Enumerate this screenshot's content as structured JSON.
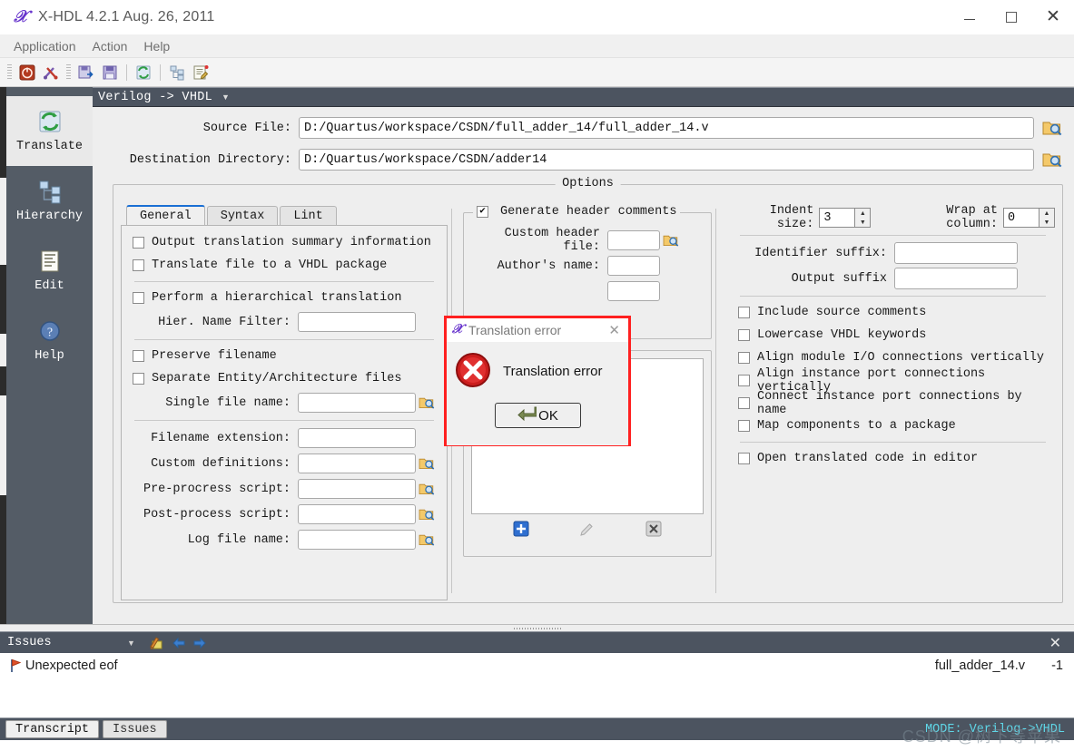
{
  "window": {
    "title": "X-HDL 4.2.1  Aug. 26, 2011",
    "app_icon": "x-hdl-logo-icon",
    "minimize": "–",
    "maximize": "□",
    "close": "✕"
  },
  "menubar": {
    "items": [
      {
        "label": "Application"
      },
      {
        "label": "Action"
      },
      {
        "label": "Help"
      }
    ]
  },
  "toolbar": {
    "buttons": [
      {
        "name": "exit-icon"
      },
      {
        "name": "settings-tools-icon"
      },
      {
        "name": "save-as-icon"
      },
      {
        "name": "save-icon"
      },
      {
        "name": "translate-icon"
      },
      {
        "name": "hierarchy-icon"
      },
      {
        "name": "edit-icon"
      }
    ]
  },
  "sidebar": {
    "items": [
      {
        "label": "Translate",
        "icon": "translate-icon",
        "active": true
      },
      {
        "label": "Hierarchy",
        "icon": "hierarchy-icon",
        "active": false
      },
      {
        "label": "Edit",
        "icon": "edit-document-icon",
        "active": false
      },
      {
        "label": "Help",
        "icon": "help-question-icon",
        "active": false
      }
    ]
  },
  "mode": {
    "label": "Verilog -> VHDL",
    "caret": "▼"
  },
  "paths": {
    "source_label": "Source File:",
    "source_value": "D:/Quartus/workspace/CSDN/full_adder_14/full_adder_14.v",
    "dest_label": "Destination Directory:",
    "dest_value": "D:/Quartus/workspace/CSDN/adder14"
  },
  "options": {
    "group_title": "Options",
    "tabs": [
      {
        "label": "General",
        "active": true
      },
      {
        "label": "Syntax",
        "active": false
      },
      {
        "label": "Lint",
        "active": false
      }
    ],
    "left_column": {
      "checkboxes_1": [
        {
          "label": "Output translation summary information",
          "checked": false
        },
        {
          "label": "Translate file to a VHDL package",
          "checked": false
        }
      ],
      "checkboxes_2": [
        {
          "label": "Perform a hierarchical translation",
          "checked": false
        }
      ],
      "field_hier": {
        "label": "Hier. Name Filter:",
        "value": ""
      },
      "checkboxes_3": [
        {
          "label": "Preserve filename",
          "checked": false
        },
        {
          "label": "Separate Entity/Architecture files",
          "checked": false
        }
      ],
      "field_single": {
        "label": "Single file name:",
        "value": "",
        "browse": true
      },
      "fields": [
        {
          "label": "Filename extension:",
          "value": "",
          "browse": false
        },
        {
          "label": "Custom definitions:",
          "value": "",
          "browse": true
        },
        {
          "label": "Pre-procress script:",
          "value": "",
          "browse": true
        },
        {
          "label": "Post-process script:",
          "value": "",
          "browse": true
        },
        {
          "label": "Log file name:",
          "value": "",
          "browse": true
        }
      ]
    },
    "mid_column": {
      "header_group_label": "Generate header comments",
      "header_group_checked": true,
      "fields": [
        {
          "label": "Custom header file:",
          "value": "",
          "browse": true
        },
        {
          "label": "Author's name:",
          "value": "",
          "browse": false
        },
        {
          "label": "",
          "value": "",
          "browse": false
        }
      ],
      "list_actions": [
        {
          "name": "add-icon",
          "glyph": "✚"
        },
        {
          "name": "edit-pencil-icon",
          "glyph": "✎"
        },
        {
          "name": "delete-icon",
          "glyph": "✖"
        }
      ]
    },
    "right_column": {
      "indent_label": "Indent size:",
      "indent_value": "3",
      "wrap_label": "Wrap at column:",
      "wrap_value": "0",
      "identifier_suffix_label": "Identifier suffix:",
      "identifier_suffix_value": "",
      "output_suffix_label": "Output suffix",
      "output_suffix_value": "",
      "checkboxes": [
        {
          "label": "Include source comments",
          "checked": false
        },
        {
          "label": "Lowercase VHDL keywords",
          "checked": false
        },
        {
          "label": "Align module I/O connections vertically",
          "checked": false
        },
        {
          "label": "Align instance port connections vertically",
          "checked": false
        },
        {
          "label": "Connect instance port connections by name",
          "checked": false
        },
        {
          "label": "Map components to a package",
          "checked": false
        }
      ],
      "checkbox_last": {
        "label": "Open translated code in editor",
        "checked": false
      }
    }
  },
  "issues_panel": {
    "title": "Issues",
    "caret": "▼",
    "toolbar_icons": [
      {
        "name": "clear-issues-icon"
      },
      {
        "name": "previous-issue-arrow-icon",
        "glyph": "⬅"
      },
      {
        "name": "next-issue-arrow-icon",
        "glyph": "➡"
      }
    ],
    "close": "✕",
    "rows": [
      {
        "flag": "error-flag-icon",
        "text": "Unexpected eof",
        "file": "full_adder_14.v",
        "line": "-1"
      }
    ],
    "bottom_tabs": [
      {
        "label": "Transcript",
        "active": true
      },
      {
        "label": "Issues",
        "active": false
      }
    ],
    "status": "MODE: Verilog->VHDL"
  },
  "dialog": {
    "title": "Translation error",
    "icon": "x-hdl-logo-icon",
    "close": "✕",
    "error_icon": "error-circle-icon",
    "message": "Translation error",
    "ok_label": "OK",
    "ok_icon": "enter-arrow-icon",
    "highlight_color": "#ff2020"
  },
  "watermark": {
    "text": "CSDN @树下等苹果"
  }
}
